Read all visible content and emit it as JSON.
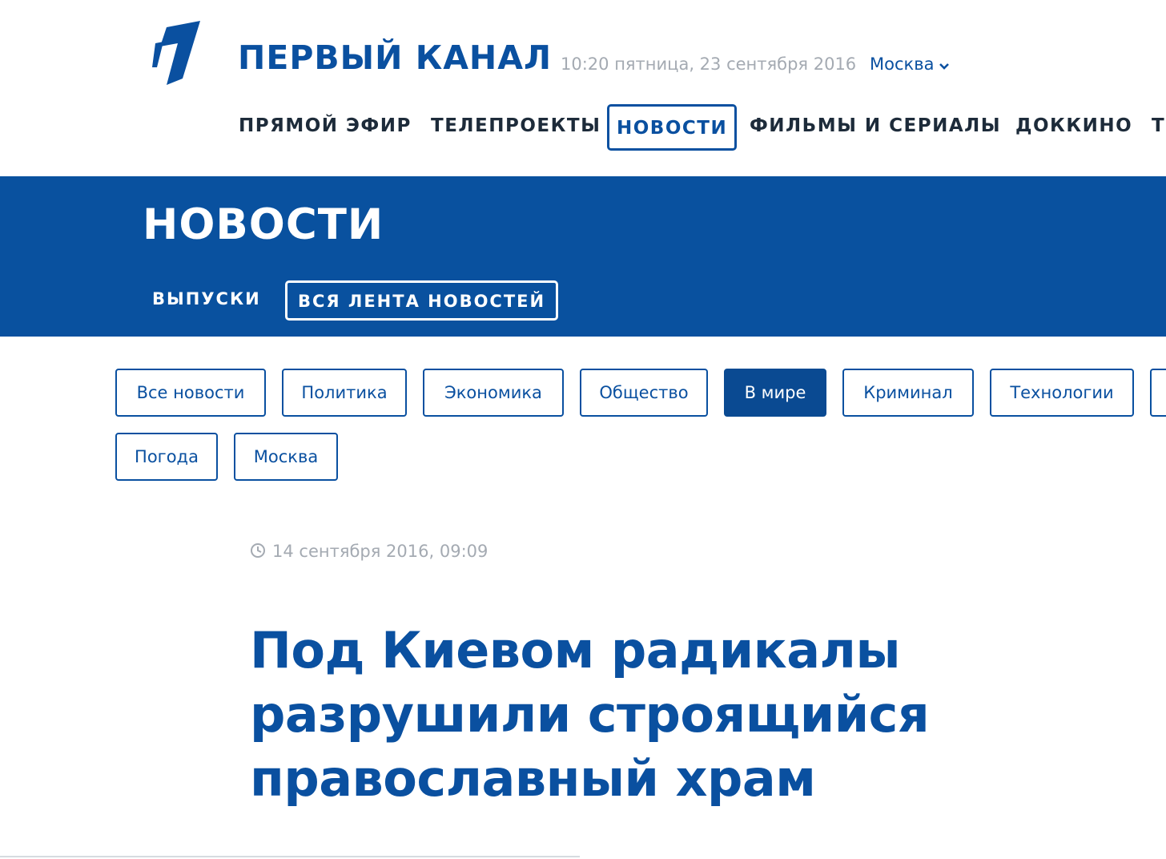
{
  "header": {
    "brand": "ПЕРВЫЙ КАНАЛ",
    "datetime": "10:20 пятница, 23 сентября 2016",
    "city": "Москва",
    "logo_icon": "channel-one-logo-icon",
    "chevron_icon": "chevron-down-icon"
  },
  "main_nav": {
    "items": [
      {
        "label": "ПРЯМОЙ ЭФИР"
      },
      {
        "label": "ТЕЛЕПРОЕКТЫ"
      },
      {
        "label": "НОВОСТИ",
        "active": true
      },
      {
        "label": "ФИЛЬМЫ И СЕРИАЛЫ"
      },
      {
        "label": "ДОККИНО"
      },
      {
        "label": "Т"
      }
    ]
  },
  "section": {
    "title": "НОВОСТИ",
    "subnav": [
      {
        "label": "ВЫПУСКИ"
      },
      {
        "label": "ВСЯ ЛЕНТА НОВОСТЕЙ",
        "active": true
      }
    ]
  },
  "categories": [
    {
      "label": "Все новости"
    },
    {
      "label": "Политика"
    },
    {
      "label": "Экономика"
    },
    {
      "label": "Общество"
    },
    {
      "label": "В мире",
      "active": true
    },
    {
      "label": "Криминал"
    },
    {
      "label": "Технологии"
    },
    {
      "label": ""
    },
    {
      "label": "Погода"
    },
    {
      "label": "Москва"
    }
  ],
  "article": {
    "date": "14 сентября 2016, 09:09",
    "clock_icon": "clock-icon",
    "title": "Под Киевом радикалы разрушили строящийся православный храм"
  },
  "colors": {
    "brand_blue": "#0a50a0",
    "band_blue": "#09519f",
    "active_category": "#0a4a92",
    "muted_text": "#a4aab2",
    "nav_text": "#1d2b3a"
  }
}
